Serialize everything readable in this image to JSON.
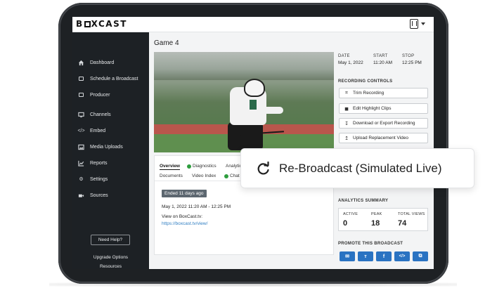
{
  "app": {
    "logo": "B□XCAST",
    "logo_parts": [
      "B",
      "XCAST"
    ]
  },
  "sidebar": {
    "items": [
      {
        "label": "Dashboard",
        "icon": "home-icon"
      },
      {
        "label": "Schedule a Broadcast",
        "icon": "calendar-icon"
      },
      {
        "label": "Producer",
        "icon": "producer-icon"
      },
      {
        "label": "Channels",
        "icon": "monitor-icon"
      },
      {
        "label": "Embed",
        "icon": "code-icon"
      },
      {
        "label": "Media Uploads",
        "icon": "image-icon"
      },
      {
        "label": "Reports",
        "icon": "chart-icon"
      },
      {
        "label": "Settings",
        "icon": "gear-icon"
      },
      {
        "label": "Sources",
        "icon": "camera-icon"
      }
    ],
    "need_help": "Need Help?",
    "upgrade": "Upgrade Options",
    "resources": "Resources"
  },
  "broadcast": {
    "title": "Game 4",
    "date_label": "DATE",
    "date_value": "May 1, 2022",
    "start_label": "START",
    "start_value": "11:20 AM",
    "stop_label": "STOP",
    "stop_value": "12:25 PM"
  },
  "tabs": {
    "overview": "Overview",
    "diagnostics": "Diagnostics",
    "analytics": "Analytic",
    "documents": "Documents",
    "video_index": "Video Index",
    "chat": "Chat"
  },
  "overview": {
    "badge": "Ended 11 days ago",
    "datetime": "May 1, 2022 11:20 AM - 12:25 PM",
    "view_on_label": "View on BoxCast.tv:",
    "view_on_link": "https://boxcast.tv/view/"
  },
  "recording_controls": {
    "label": "RECORDING CONTROLS",
    "buttons": [
      {
        "label": "Trim Recording",
        "icon": "crop-icon"
      },
      {
        "label": "Edit Highlight Clips",
        "icon": "camera-icon"
      },
      {
        "label": "Download or Export Recording",
        "icon": "download-icon"
      },
      {
        "label": "Upload Replacement Video",
        "icon": "upload-icon"
      }
    ]
  },
  "analytics": {
    "label": "ANALYTICS SUMMARY",
    "active_label": "ACTIVE",
    "active_value": "0",
    "peak_label": "PEAK",
    "peak_value": "18",
    "total_label": "TOTAL VIEWS",
    "total_value": "74"
  },
  "promote": {
    "label": "PROMOTE THIS BROADCAST",
    "buttons": [
      {
        "name": "email-share-button",
        "glyph": "✉"
      },
      {
        "name": "twitter-share-button",
        "glyph": "ᴛ"
      },
      {
        "name": "facebook-share-button",
        "glyph": "f"
      },
      {
        "name": "embed-share-button",
        "glyph": "</>"
      },
      {
        "name": "copy-share-button",
        "glyph": "⧉"
      }
    ]
  },
  "popup": {
    "label": "Re-Broadcast (Simulated Live)",
    "icon": "refresh-icon"
  },
  "colors": {
    "sidebar_bg": "#1d2125",
    "accent_blue": "#2a73c2",
    "link_blue": "#2f7ec2",
    "status_green": "#2e9d3e"
  }
}
